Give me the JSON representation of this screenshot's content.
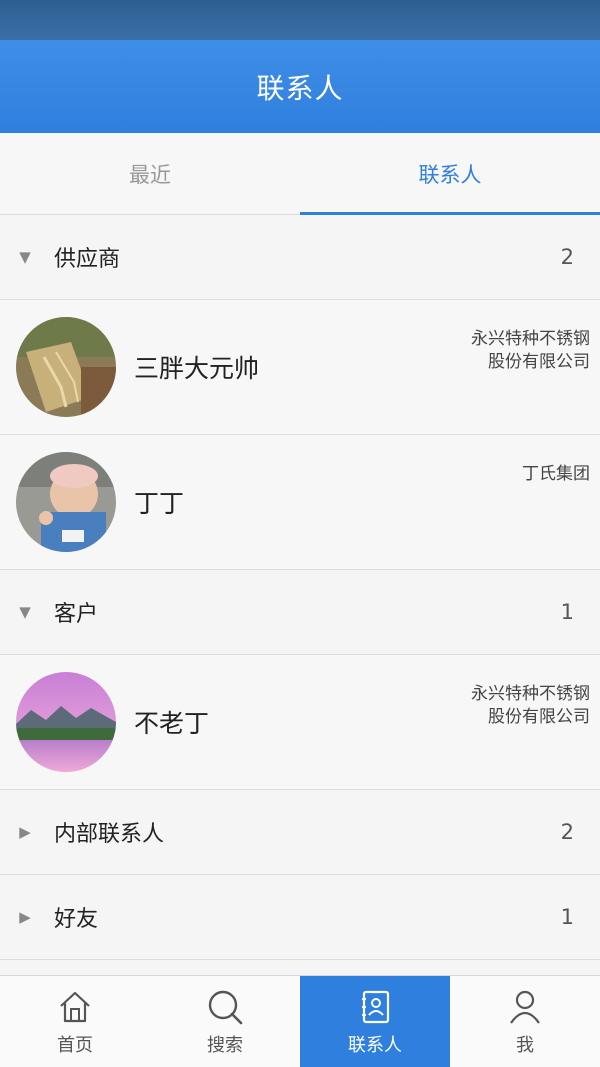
{
  "header": {
    "title": "联系人"
  },
  "tabs": [
    {
      "label": "最近",
      "active": false
    },
    {
      "label": "联系人",
      "active": true
    }
  ],
  "groups": [
    {
      "label": "供应商",
      "count": "2",
      "expanded": true,
      "contacts": [
        {
          "name": "三胖大元帅",
          "company_line1": "永兴特种不锈钢",
          "company_line2": "股份有限公司",
          "avatar": "cloth-photo"
        },
        {
          "name": "丁丁",
          "company_line1": "丁氏集团",
          "company_line2": "",
          "avatar": "baby-photo"
        }
      ]
    },
    {
      "label": "客户",
      "count": "1",
      "expanded": true,
      "contacts": [
        {
          "name": "不老丁",
          "company_line1": "永兴特种不锈钢",
          "company_line2": "股份有限公司",
          "avatar": "landscape-photo"
        }
      ]
    },
    {
      "label": "内部联系人",
      "count": "2",
      "expanded": false
    },
    {
      "label": "好友",
      "count": "1",
      "expanded": false
    }
  ],
  "bottom_nav": [
    {
      "label": "首页",
      "icon": "home-icon",
      "active": false
    },
    {
      "label": "搜索",
      "icon": "search-icon",
      "active": false
    },
    {
      "label": "联系人",
      "icon": "contacts-book-icon",
      "active": true
    },
    {
      "label": "我",
      "icon": "person-icon",
      "active": false
    }
  ],
  "colors": {
    "accent": "#2f7fde",
    "header": "#3f8ee6",
    "status_bar": "#2e5f92"
  }
}
